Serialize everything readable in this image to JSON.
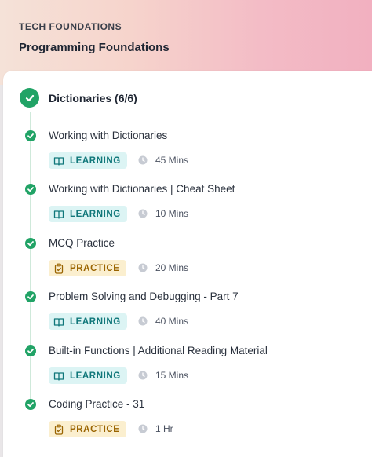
{
  "header": {
    "kicker": "TECH FOUNDATIONS",
    "course": "Programming Foundations"
  },
  "section": {
    "title": "Dictionaries (6/6)"
  },
  "items": [
    {
      "title": "Working with Dictionaries",
      "type": "LEARNING",
      "duration": "45 Mins"
    },
    {
      "title": "Working with Dictionaries | Cheat Sheet",
      "type": "LEARNING",
      "duration": "10 Mins"
    },
    {
      "title": "MCQ Practice",
      "type": "PRACTICE",
      "duration": "20 Mins"
    },
    {
      "title": "Problem Solving and Debugging - Part 7",
      "type": "LEARNING",
      "duration": "40 Mins"
    },
    {
      "title": "Built-in Functions | Additional Reading Material",
      "type": "LEARNING",
      "duration": "15 Mins"
    },
    {
      "title": "Coding Practice - 31",
      "type": "PRACTICE",
      "duration": "1 Hr"
    }
  ],
  "colors": {
    "success": "#21a366",
    "learning_bg": "#dcf4f4",
    "learning_fg": "#10777a",
    "practice_bg": "#fbefcf",
    "practice_fg": "#9a6400"
  },
  "icons": {
    "section": "check-circle-icon",
    "item": "check-dot-icon",
    "learning": "book-icon",
    "practice": "clipboard-icon",
    "duration": "clock-icon"
  }
}
